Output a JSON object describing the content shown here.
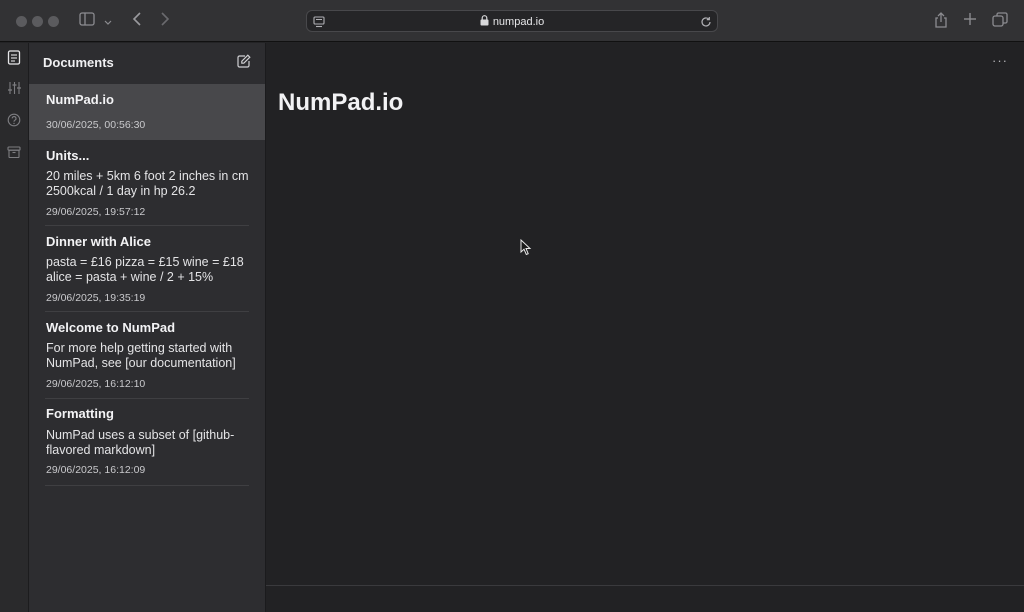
{
  "browser": {
    "url": "numpad.io"
  },
  "sidebar": {
    "title": "Documents",
    "documents": [
      {
        "title": "NumPad.io",
        "preview": "",
        "date": "30/06/2025, 00:56:30",
        "selected": true
      },
      {
        "title": "Units...",
        "preview": "20 miles + 5km 6 foot 2 inches in cm 2500kcal / 1 day in hp 26.2",
        "date": "29/06/2025, 19:57:12"
      },
      {
        "title": "Dinner with Alice",
        "preview": "pasta = £16 pizza = £15 wine = £18 alice = pasta + wine / 2 + 15%",
        "date": "29/06/2025, 19:35:19"
      },
      {
        "title": "Welcome to NumPad",
        "preview": "For more help getting started with NumPad, see [our documentation]",
        "date": "29/06/2025, 16:12:10"
      },
      {
        "title": "Formatting",
        "preview": "NumPad uses a subset of [github-flavored markdown]",
        "date": "29/06/2025, 16:12:09"
      }
    ]
  },
  "main": {
    "title": "NumPad.io",
    "more_label": "···"
  },
  "colors": {
    "background": "#222224",
    "sidebar": "#2d2d30",
    "selected": "#48484b",
    "chrome": "#323234"
  }
}
